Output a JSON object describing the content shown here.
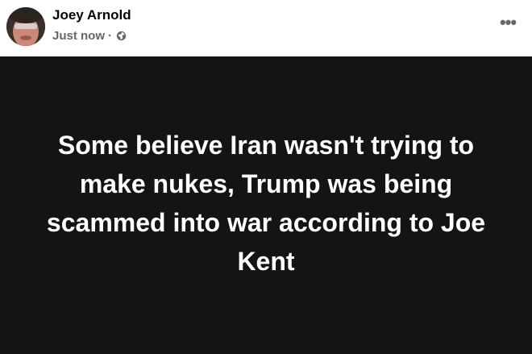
{
  "post": {
    "author": "Joey Arnold",
    "timestamp": "Just now",
    "separator": "·",
    "privacy_icon": "globe-icon",
    "more_icon": "more-options-icon",
    "more_label": "•••",
    "text": "Some believe Iran wasn't trying to make nukes, Trump was being scammed into war according to Joe Kent",
    "body_background": "#141414",
    "text_color": "#ffffff"
  }
}
